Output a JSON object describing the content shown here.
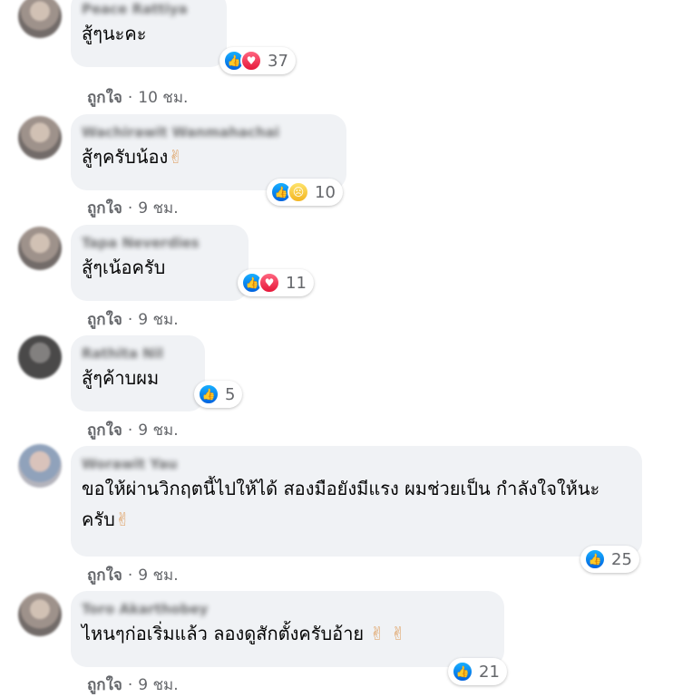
{
  "comments": [
    {
      "author": "Peace Rattiya",
      "text": "สู้ๆนะคะ",
      "reactions": [
        "like",
        "love"
      ],
      "count": "37",
      "like_label": "ถูกใจ",
      "time": "10 ชม."
    },
    {
      "author": "Wachirawit Wanmahachai",
      "text": "สู้ๆครับน้อง",
      "emoji": "✌",
      "reactions": [
        "like",
        "sad"
      ],
      "count": "10",
      "like_label": "ถูกใจ",
      "time": "9 ชม."
    },
    {
      "author": "Tapa Neverdies",
      "text": "สู้ๆเน้อครับ",
      "reactions": [
        "like",
        "love"
      ],
      "count": "11",
      "like_label": "ถูกใจ",
      "time": "9 ชม."
    },
    {
      "author": "Rathita Nil",
      "text": "สู้ๆค้าบผม",
      "reactions": [
        "like"
      ],
      "count": "5",
      "like_label": "ถูกใจ",
      "time": "9 ชม."
    },
    {
      "author": "Worawit Yau",
      "text": "ขอให้ผ่านวิกฤตนี้ไปให้ได้ สองมือยังมีแรง ผมช่วยเป็น กำลังใจให้นะครับ",
      "emoji": "✌",
      "reactions": [
        "like"
      ],
      "count": "25",
      "like_label": "ถูกใจ",
      "time": "9 ชม."
    },
    {
      "author": "Toro Akarthobey",
      "text": "ไหนๆก่อเริ่มแล้ว ลองดูสักตั้งครับอ้าย",
      "emoji": "✌ ✌",
      "reactions": [
        "like"
      ],
      "count": "21",
      "like_label": "ถูกใจ",
      "time": "9 ชม."
    }
  ],
  "icons": {
    "like": "thumbs-up-icon",
    "love": "heart-icon",
    "sad": "sad-face-icon"
  }
}
